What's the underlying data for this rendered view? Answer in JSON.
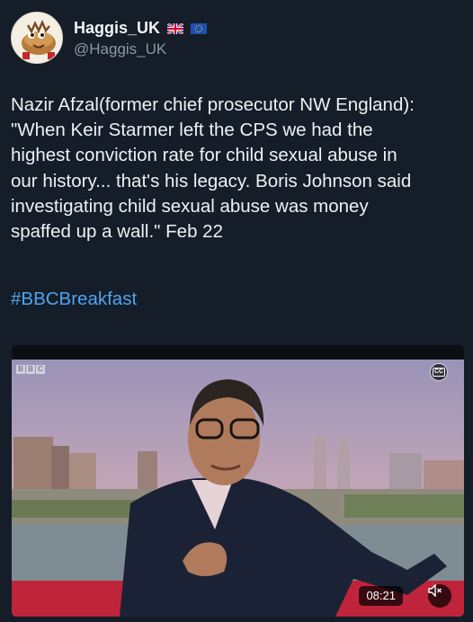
{
  "author": {
    "display_name": "Haggis_UK",
    "handle": "@Haggis_UK",
    "avatar_icon": "haggis-cartoon-avatar",
    "badges": [
      "uk-flag-icon",
      "eu-flag-icon"
    ]
  },
  "tweet": {
    "text": "Nazir Afzal(former chief prosecutor NW England):\n\"When Keir Starmer left the CPS we had the\nhighest conviction rate for child sexual abuse in\nour history... that's his legacy. Boris Johnson said\ninvestigating child sexual abuse was money\nspaffed up a wall.\" Feb 22",
    "hashtag": "#BBCBreakfast"
  },
  "media": {
    "type": "video",
    "channel_logo": "BBC",
    "captions_label": "CC",
    "duration": "08:21",
    "mute_icon": "speaker-muted-icon"
  },
  "colors": {
    "background": "#141d28",
    "hashtag": "#4fa3ef",
    "secondary_text": "#8b98a5"
  }
}
